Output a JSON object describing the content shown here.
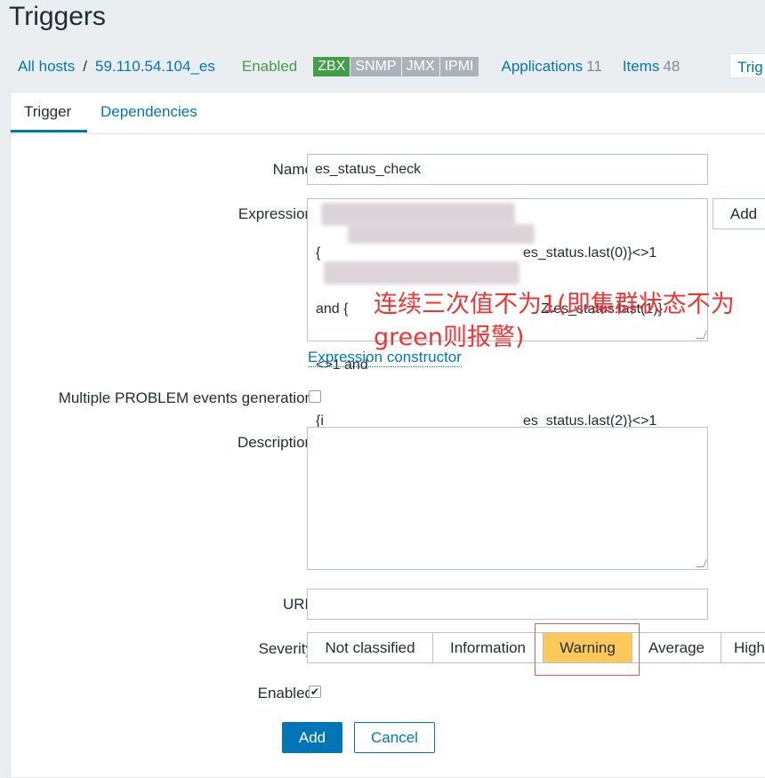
{
  "page": {
    "title": "Triggers"
  },
  "breadcrumb": {
    "all_hosts": "All hosts",
    "separator": "/",
    "host": "59.110.54.104_es",
    "status": "Enabled",
    "badges": [
      "ZBX",
      "SNMP",
      "JMX",
      "IPMI"
    ],
    "applications_label": "Applications",
    "applications_count": "11",
    "items_label": "Items",
    "items_count": "48",
    "triggers_label": "Trig"
  },
  "tabs": {
    "trigger": "Trigger",
    "dependencies": "Dependencies"
  },
  "form": {
    "name_label": "Name",
    "name_value": "es_status_check",
    "expression_label": "Expression",
    "expression_lines": [
      "{",
      "es_status.last(0)}<>1",
      "and {",
      "Z:es_status.last(1)}",
      "<>1 and",
      "{i",
      "es_status.last(2)}<>1"
    ],
    "expression_add": "Add",
    "expression_constructor": "Expression constructor",
    "multiple_label": "Multiple PROBLEM events generation",
    "description_label": "Description",
    "url_label": "URL",
    "severity_label": "Severity",
    "severity_options": [
      "Not classified",
      "Information",
      "Warning",
      "Average",
      "High"
    ],
    "severity_selected": "Warning",
    "enabled_label": "Enabled",
    "enabled_checkmark": "✔",
    "add_button": "Add",
    "cancel_button": "Cancel"
  },
  "annotation": {
    "text": "连续三次值不为1(即集群状态不为green则报警)"
  },
  "colors": {
    "accent": "#0275b8",
    "enabled": "#429e47",
    "warning": "#ffc859",
    "annotation": "#ef3534"
  }
}
